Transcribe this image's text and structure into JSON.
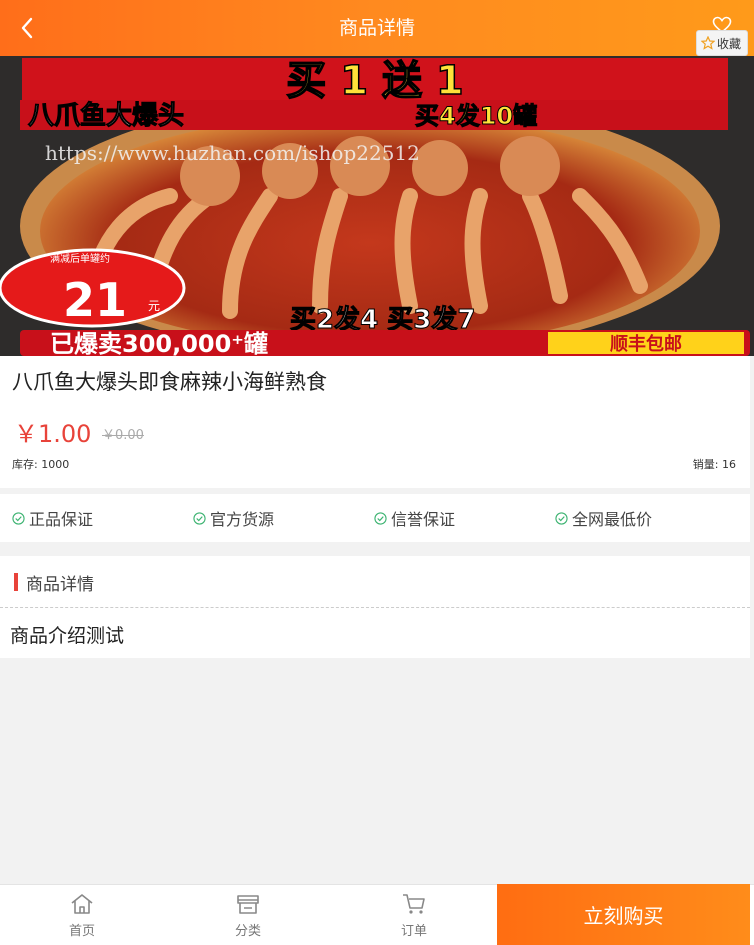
{
  "header": {
    "title": "商品详情",
    "favorite_label": "收藏"
  },
  "banner": {
    "headline": "买 1 送 1",
    "subline_left": "八爪鱼大爆头",
    "subline_right": "买4发10罐",
    "watermark": "https://www.huzhan.com/ishop22512",
    "badge_top": "满减后单罐约",
    "badge_price": "21",
    "badge_unit": "元",
    "promo_line": "买2发4  买3发7",
    "sold_line": "已爆卖300,000⁺罐",
    "shipping": "顺丰包邮"
  },
  "product": {
    "name": "八爪鱼大爆头即食麻辣小海鲜熟食",
    "price": "￥1.00",
    "original_price": "￥0.00",
    "stock": "库存: 1000",
    "sales": "销量: 16"
  },
  "guarantees": [
    "正品保证",
    "官方货源",
    "信誉保证",
    "全网最低价"
  ],
  "detail": {
    "title": "商品详情",
    "body": "商品介绍测试"
  },
  "tabbar": {
    "items": [
      {
        "label": "首页",
        "icon": "home-icon"
      },
      {
        "label": "分类",
        "icon": "category-icon"
      },
      {
        "label": "订单",
        "icon": "cart-icon"
      }
    ],
    "buy_label": "立刻购买"
  },
  "colors": {
    "accent": "#ff7a1a",
    "price": "#e8433a",
    "check": "#3cb371"
  }
}
